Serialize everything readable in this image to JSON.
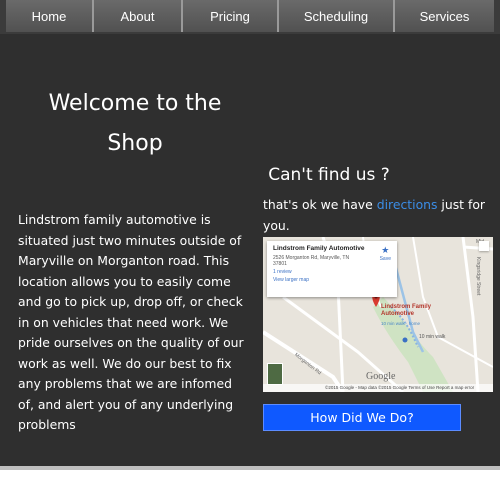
{
  "nav": {
    "items": [
      {
        "label": "Home"
      },
      {
        "label": "About"
      },
      {
        "label": "Pricing"
      },
      {
        "label": "Scheduling"
      },
      {
        "label": "Services"
      }
    ]
  },
  "welcome": {
    "title_line1": "Welcome to the",
    "title_line2": "Shop"
  },
  "about": {
    "text": "Lindstrom family automotive is situated just two minutes outside of Maryville on Morganton road. This location allows you to easily come and go to pick up, drop off, or check in on vehicles that need work. We pride ourselves on the quality of our work as well. We do our best to fix any problems that we are infomed of, and alert you of any underlying problems"
  },
  "findus": {
    "heading": "Can't find us ?",
    "text_before": "that's ok we have ",
    "link": "directions",
    "text_after": " just for you."
  },
  "map": {
    "card_title": "Lindstrom Family Automotive",
    "card_address": "2526 Morganton Rd, Maryville, TN 37801",
    "card_reviews": "1 review",
    "card_larger": "View larger map",
    "card_save": "Save",
    "pin_label_line1": "Lindstrom Family",
    "pin_label_line2": "Automotive",
    "walk_label": "10 min walk · home",
    "walk_time": "10 min walk",
    "street_kingsridge": "Kingsridge Street",
    "street_morganton": "Morganton Rd",
    "street_mid": "Mid",
    "google_logo": "Google",
    "footer": "©2015 Google - Map data ©2015 Google   Terms of Use   Report a map error",
    "colors": {
      "pin": "#d93b30",
      "water": "#9cc3e6",
      "road": "#ffffff",
      "land": "#e8e4dc",
      "green": "#cfe3c3"
    }
  },
  "feedback_button": {
    "label": "How Did We Do?",
    "color": "#0f59ff"
  }
}
